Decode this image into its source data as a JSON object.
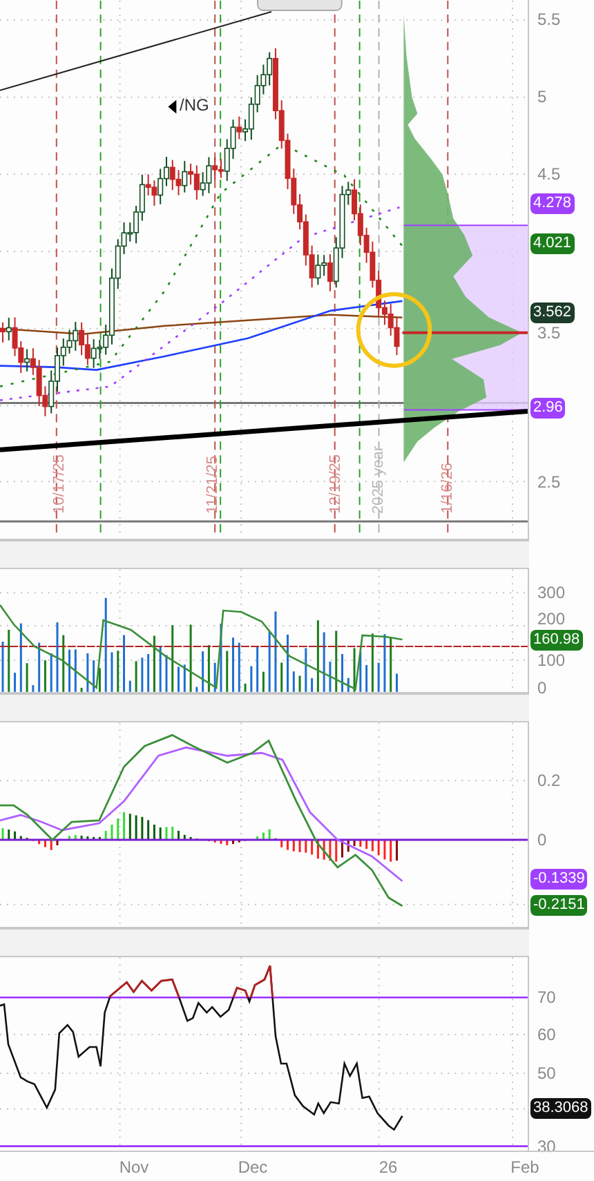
{
  "price_panel": {
    "symbol": "/NG",
    "y_axis": [
      "5.5",
      "5",
      "4.5",
      "3.5",
      "2.5"
    ],
    "badges": [
      {
        "text": "4.278",
        "color": "#a040ff"
      },
      {
        "text": "4.021",
        "color": "#1b7d1b"
      },
      {
        "text": "3.562",
        "color": "#1d3d2a"
      },
      {
        "text": "2.96",
        "color": "#a040ff"
      }
    ],
    "date_markers": [
      {
        "label": "10/17/25",
        "kind": "date"
      },
      {
        "label": "11/21/25",
        "kind": "date"
      },
      {
        "label": "12/19/25",
        "kind": "date"
      },
      {
        "label": "2025 year",
        "kind": "year"
      },
      {
        "label": "1/16/26",
        "kind": "date"
      }
    ]
  },
  "volume_panel": {
    "y_axis": [
      "300",
      "200",
      "100",
      "0"
    ],
    "badges": [
      {
        "text": "160.98",
        "color": "#1b7d1b"
      }
    ]
  },
  "macd_panel": {
    "y_axis": [
      "0.2",
      "0"
    ],
    "badges": [
      {
        "text": "-0.1339",
        "color": "#a040ff"
      },
      {
        "text": "-0.2151",
        "color": "#1b7d1b"
      }
    ]
  },
  "rsi_panel": {
    "y_axis": [
      "70",
      "60",
      "50",
      "30"
    ],
    "badges": [
      {
        "text": "38.3068",
        "color": "#111111"
      }
    ]
  },
  "x_axis": [
    "Nov",
    "Dec",
    "26",
    "Feb"
  ]
}
